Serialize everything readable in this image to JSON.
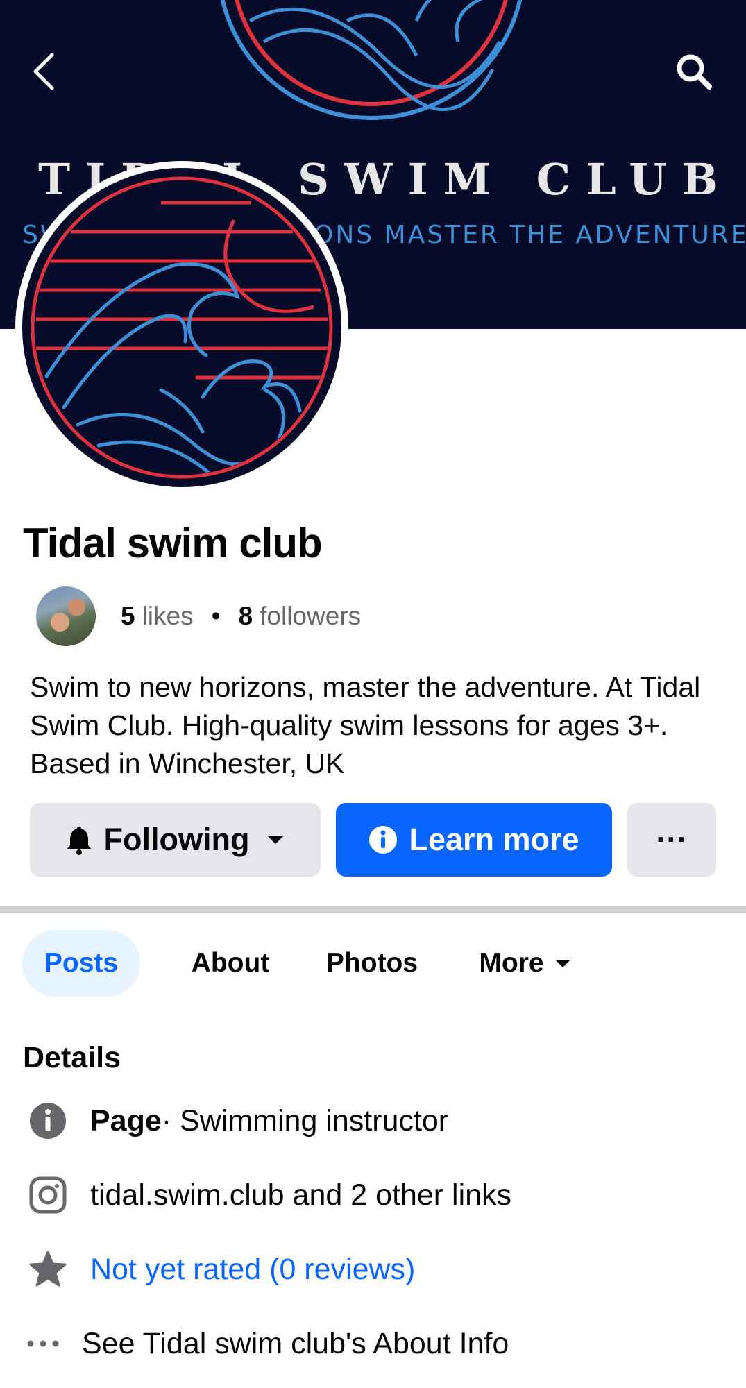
{
  "cover": {
    "club_name": "TIDAL SWIM CLUB",
    "tagline_start": "SW",
    "tagline_end": "ONS MASTER THE ADVENTURE"
  },
  "header": {
    "back_icon": "chevron-left-icon",
    "search_icon": "search-icon"
  },
  "page": {
    "title": "Tidal swim club",
    "likes_count": "5",
    "likes_label": "likes",
    "separator": "•",
    "followers_count": "8",
    "followers_label": "followers",
    "bio": "Swim to new horizons, master the adventure. At Tidal Swim Club. High-quality swim lessons for ages 3+. Based in Winchester, UK"
  },
  "actions": {
    "following_label": "Following",
    "learn_more_label": "Learn more",
    "more_label": "···"
  },
  "tabs": [
    {
      "label": "Posts",
      "active": true
    },
    {
      "label": "About",
      "active": false
    },
    {
      "label": "Photos",
      "active": false
    },
    {
      "label": "More",
      "active": false
    }
  ],
  "details": {
    "title": "Details",
    "page_label": "Page",
    "page_category": " · Swimming instructor",
    "links_text": "tidal.swim.club and 2 other links",
    "rating_text": "Not yet rated (0 reviews)",
    "about_text": "See Tidal swim club's About Info"
  },
  "colors": {
    "accent": "#0866ff",
    "cover_bg": "#070b2a",
    "logo_red": "#e0313f",
    "logo_blue": "#3d8fd6"
  }
}
